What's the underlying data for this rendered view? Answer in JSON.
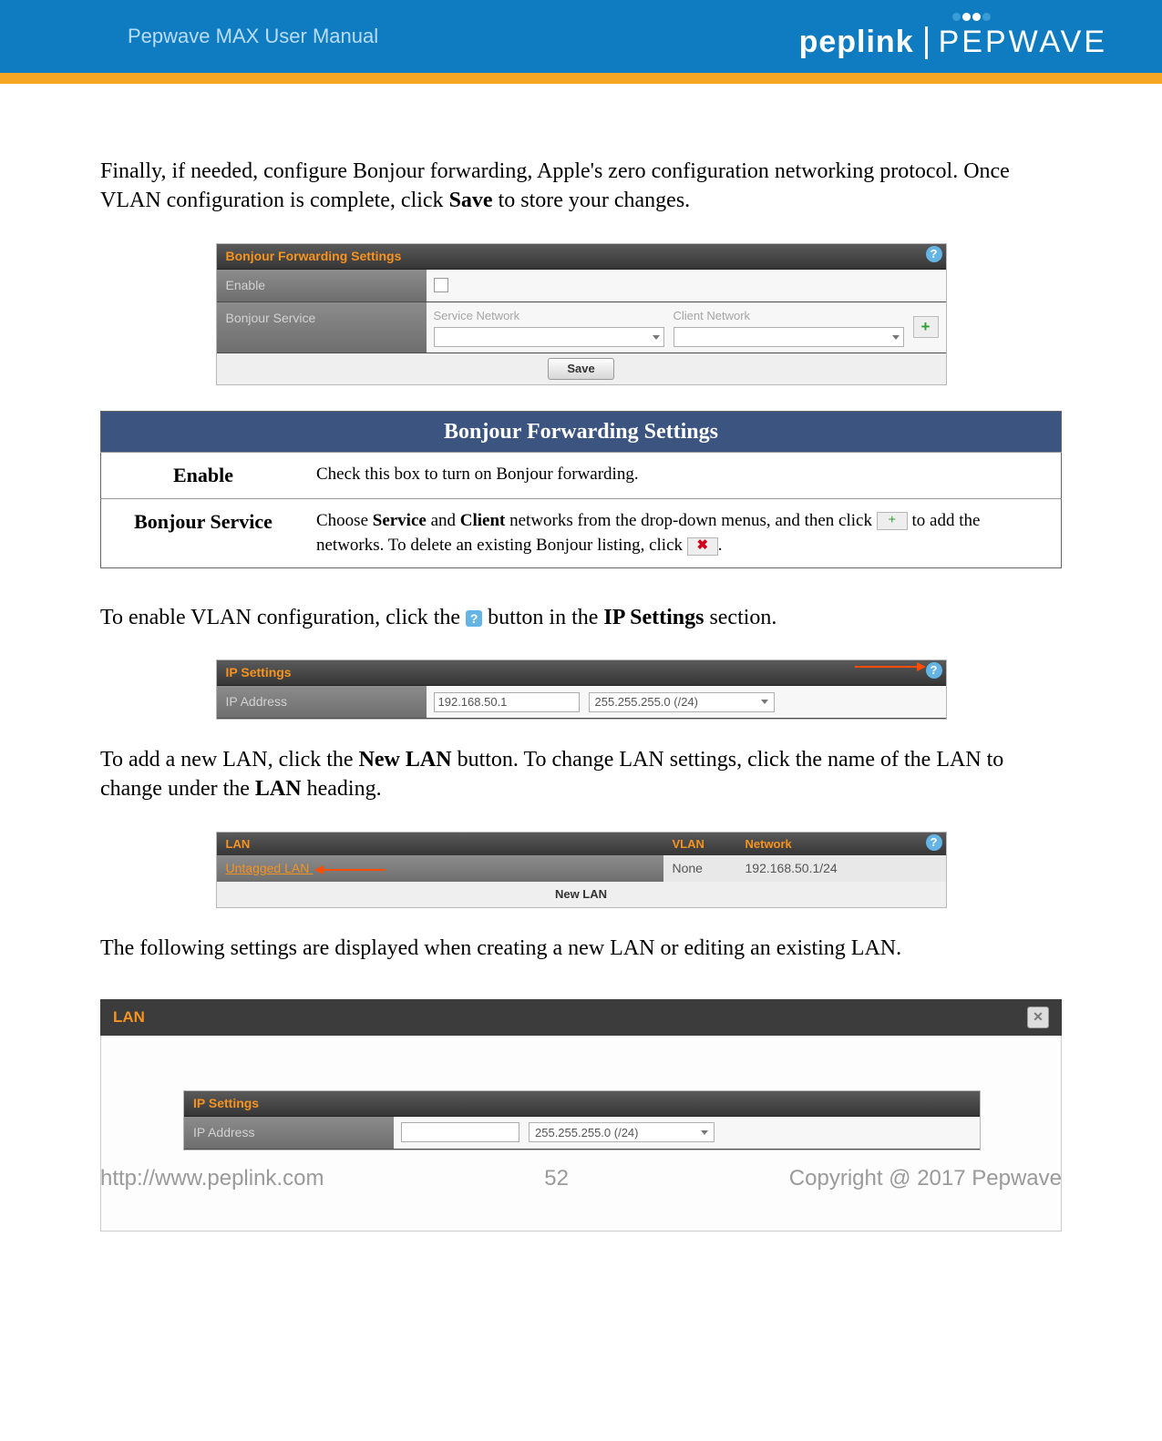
{
  "banner": {
    "title": "Pepwave MAX User Manual",
    "brand1": "peplink",
    "brand2": "PEPWAVE"
  },
  "intro": {
    "pre": "Finally, if needed, configure Bonjour forwarding, Apple's zero configuration networking protocol. Once VLAN configuration is complete, click ",
    "bold1": "Save",
    "post": " to store your changes."
  },
  "bonjour_panel": {
    "title": "Bonjour Forwarding Settings",
    "enable_label": "Enable",
    "service_label": "Bonjour Service",
    "col_service": "Service Network",
    "col_client": "Client Network",
    "save_label": "Save"
  },
  "desc_table": {
    "header": "Bonjour Forwarding Settings",
    "row1_name": "Enable",
    "row1_desc": "Check this box to turn on Bonjour forwarding.",
    "row2_name": "Bonjour Service",
    "row2_p1": "Choose ",
    "row2_b1": "Service",
    "row2_p2": " and ",
    "row2_b2": "Client",
    "row2_p3": " networks from the drop-down menus, and then click ",
    "row2_p4": " to add the networks. To delete an existing Bonjour listing, click ",
    "row2_p5": "."
  },
  "vlan_line": {
    "p1": "To enable VLAN configuration, click the ",
    "p2": " button in the ",
    "b1": "IP Settings",
    "p3": " section."
  },
  "ip_panel": {
    "title": "IP Settings",
    "row_label": "IP Address",
    "ip_value": "192.168.50.1",
    "mask_value": "255.255.255.0 (/24)"
  },
  "newlan_line": {
    "p1": "To add a new LAN, click the ",
    "b1": "New LAN",
    "p2": " button. To change LAN settings, click the name of the LAN to change under the ",
    "b2": "LAN",
    "p3": " heading."
  },
  "lan_panel": {
    "h_lan": "LAN",
    "h_vlan": "VLAN",
    "h_net": "Network",
    "row_name": "Untagged LAN",
    "row_vlan": "None",
    "row_net": "192.168.50.1/24",
    "newlan_label": "New LAN"
  },
  "after_list": "The following settings are displayed when creating a new LAN or editing an existing LAN.",
  "lan_edit": {
    "header": "LAN",
    "ip_title": "IP Settings",
    "ip_label": "IP Address",
    "mask_value": "255.255.255.0 (/24)"
  },
  "footer": {
    "url": "http://www.peplink.com",
    "page": "52",
    "copyright": "Copyright @ 2017 Pepwave"
  }
}
